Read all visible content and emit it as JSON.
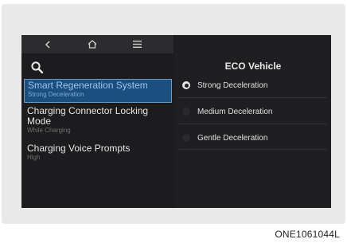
{
  "topbar": {
    "back_icon": "chevron-left-icon",
    "home_icon": "home-icon",
    "menu_icon": "menu-icon"
  },
  "search_icon": "search-icon",
  "settings_list": [
    {
      "title": "Smart Regeneration System",
      "subtitle": "Strong Deceleration",
      "selected": true
    },
    {
      "title": "Charging Connector Locking Mode",
      "subtitle": "While Charging",
      "selected": false
    },
    {
      "title": "Charging Voice Prompts",
      "subtitle": "High",
      "selected": false
    }
  ],
  "panel": {
    "title": "ECO Vehicle",
    "options": [
      {
        "label": "Strong Deceleration",
        "checked": true
      },
      {
        "label": "Medium Deceleration",
        "checked": false
      },
      {
        "label": "Gentle Deceleration",
        "checked": false
      }
    ]
  },
  "caption": "ONE1061044L",
  "colors": {
    "selection": "#1a4f80",
    "selection_text": "#9fc5ec",
    "screen_bg": "#1d1d1f"
  }
}
